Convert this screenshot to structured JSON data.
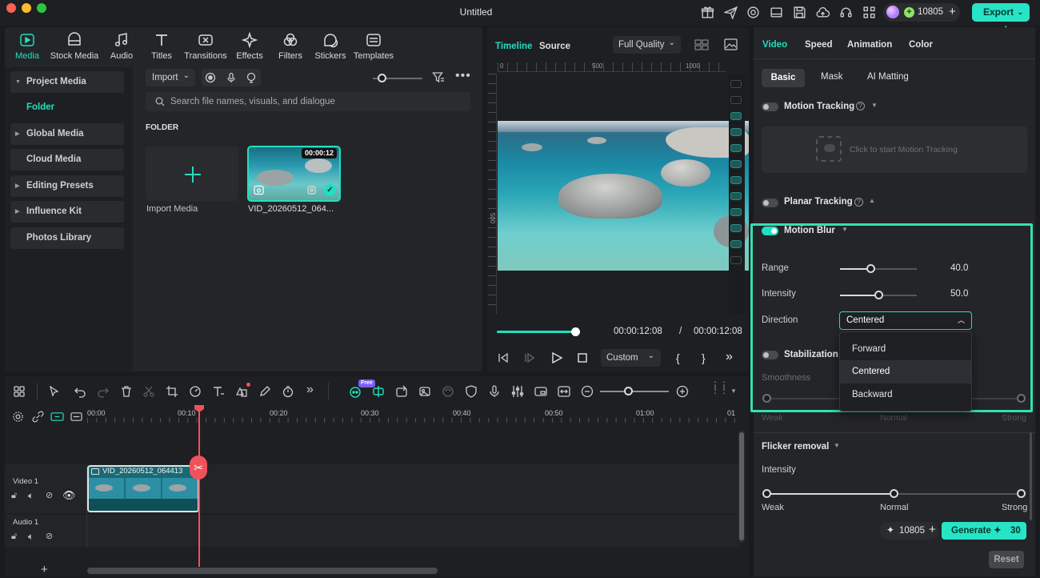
{
  "app": {
    "title": "Untitled",
    "credits": "10805",
    "export_label": "Export"
  },
  "media": {
    "tabs": [
      "Media",
      "Stock Media",
      "Audio",
      "Titles",
      "Transitions",
      "Effects",
      "Filters",
      "Stickers",
      "Templates"
    ],
    "sidebar": {
      "project_media": "Project Media",
      "folder": "Folder",
      "global_media": "Global Media",
      "cloud_media": "Cloud Media",
      "editing_presets": "Editing Presets",
      "influence_kit": "Influence Kit",
      "photos_library": "Photos Library"
    },
    "import_label": "Import",
    "search_placeholder": "Search file names, visuals, and dialogue",
    "folder_heading": "FOLDER",
    "import_media_label": "Import Media",
    "clip": {
      "name": "VID_20260512_064...",
      "duration": "00:00:12"
    }
  },
  "preview": {
    "tab_timeline": "Timeline",
    "tab_source": "Source",
    "quality": "Full Quality",
    "ruler": [
      "0",
      "500",
      "1000"
    ],
    "vruler": [
      "500"
    ],
    "current_time": "00:00:12:08",
    "separator": "/",
    "total_time": "00:00:12:08",
    "ratio": "Custom",
    "progress": 1.0
  },
  "props": {
    "tabs": [
      "Video",
      "Speed",
      "Animation",
      "Color"
    ],
    "subtabs": [
      "Basic",
      "Mask",
      "AI Matting"
    ],
    "motion_tracking": "Motion Tracking",
    "motion_tracking_hint": "Click to start Motion Tracking",
    "planar_tracking": "Planar Tracking",
    "motion_blur": "Motion Blur",
    "range_label": "Range",
    "range_value": "40.0",
    "intensity_label": "Intensity",
    "intensity_value": "50.0",
    "direction_label": "Direction",
    "direction_value": "Centered",
    "direction_options": [
      "Forward",
      "Centered",
      "Backward"
    ],
    "stabilization": "Stabilization",
    "smoothness": "Smoothness",
    "levels": [
      "Weak",
      "Normal",
      "Strong"
    ],
    "flicker_removal": "Flicker removal",
    "flicker_intensity": "Intensity",
    "credits": "10805",
    "generate_label": "Generate",
    "generate_cost": "30",
    "reset_label": "Reset",
    "range_level": 0.4,
    "intensity_level": 0.5,
    "flicker_level": 0.5
  },
  "timeline": {
    "ruler": [
      "00:00",
      "00:10",
      "00:20",
      "00:30",
      "00:40",
      "00:50",
      "01:00",
      "01"
    ],
    "free_badge": "Free",
    "video_track": "Video 1",
    "audio_track": "Audio 1",
    "clip_name": "VID_20260512_064413"
  },
  "colors": {
    "accent": "#1fe0c0",
    "export": "#27e4c6",
    "playhead": "#f0525b"
  }
}
